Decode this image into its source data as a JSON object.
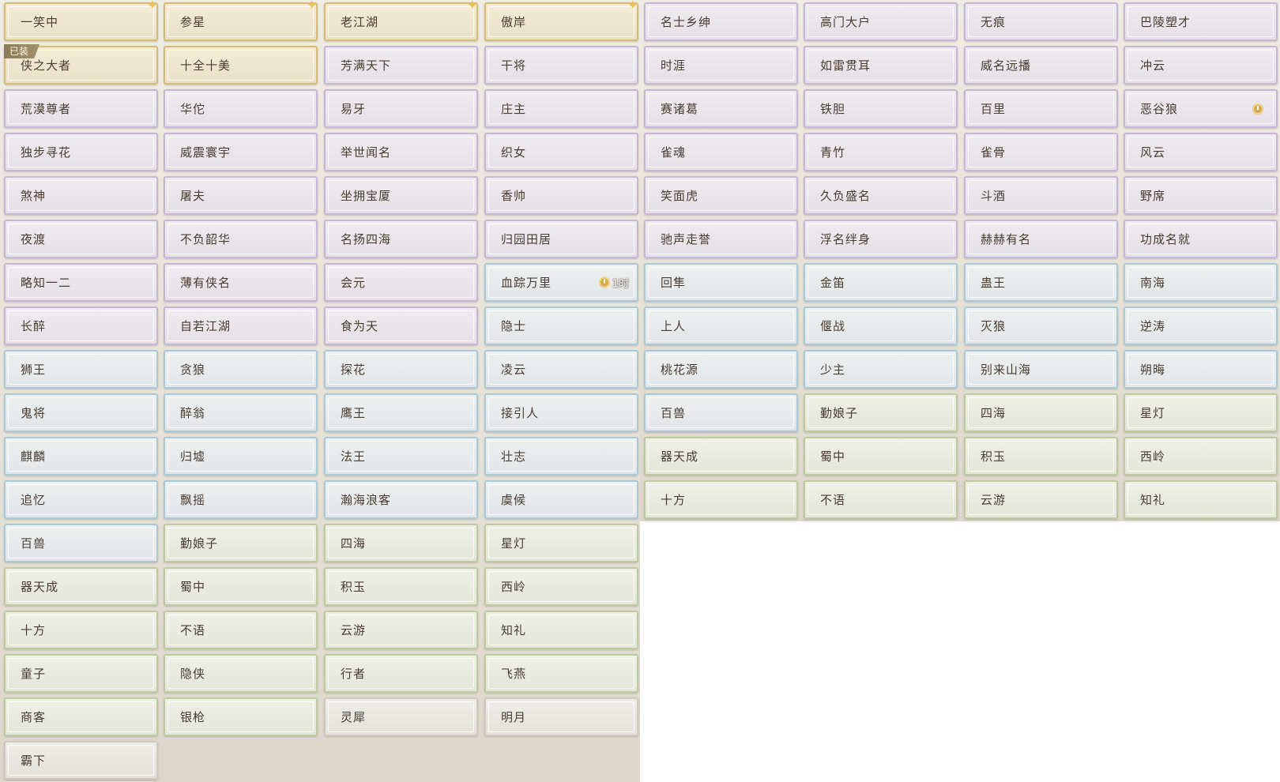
{
  "title_grid_right": {
    "rows": [
      [
        {
          "label": "名士乡绅",
          "tier": "purple"
        },
        {
          "label": "高门大户",
          "tier": "purple"
        },
        {
          "label": "无痕",
          "tier": "purple"
        },
        {
          "label": "巴陵塑才",
          "tier": "purple"
        }
      ],
      [
        {
          "label": "时涯",
          "tier": "purple"
        },
        {
          "label": "如雷贯耳",
          "tier": "purple"
        },
        {
          "label": "威名远播",
          "tier": "purple"
        },
        {
          "label": "冲云",
          "tier": "purple"
        }
      ],
      [
        {
          "label": "赛诸葛",
          "tier": "purple"
        },
        {
          "label": "铁胆",
          "tier": "purple"
        },
        {
          "label": "百里",
          "tier": "purple"
        },
        {
          "label": "恶谷狼",
          "tier": "purple",
          "timed": true
        }
      ],
      [
        {
          "label": "雀魂",
          "tier": "purple"
        },
        {
          "label": "青竹",
          "tier": "purple"
        },
        {
          "label": "雀骨",
          "tier": "purple"
        },
        {
          "label": "风云",
          "tier": "purple"
        }
      ],
      [
        {
          "label": "笑面虎",
          "tier": "purple"
        },
        {
          "label": "久负盛名",
          "tier": "purple"
        },
        {
          "label": "斗酒",
          "tier": "purple"
        },
        {
          "label": "野席",
          "tier": "purple"
        }
      ],
      [
        {
          "label": "驰声走誉",
          "tier": "purple"
        },
        {
          "label": "浮名绊身",
          "tier": "purple"
        },
        {
          "label": "赫赫有名",
          "tier": "purple"
        },
        {
          "label": "功成名就",
          "tier": "purple"
        }
      ],
      [
        {
          "label": "回隼",
          "tier": "blue"
        },
        {
          "label": "金笛",
          "tier": "blue"
        },
        {
          "label": "蛊王",
          "tier": "blue"
        },
        {
          "label": "南海",
          "tier": "blue"
        }
      ],
      [
        {
          "label": "上人",
          "tier": "blue"
        },
        {
          "label": "偃战",
          "tier": "blue"
        },
        {
          "label": "灭狼",
          "tier": "blue"
        },
        {
          "label": "逆涛",
          "tier": "blue"
        }
      ],
      [
        {
          "label": "桃花源",
          "tier": "blue"
        },
        {
          "label": "少主",
          "tier": "blue"
        },
        {
          "label": "别来山海",
          "tier": "blue"
        },
        {
          "label": "朔晦",
          "tier": "blue"
        }
      ],
      [
        {
          "label": "百兽",
          "tier": "blue"
        },
        {
          "label": "勤娘子",
          "tier": "green"
        },
        {
          "label": "四海",
          "tier": "green"
        },
        {
          "label": "星灯",
          "tier": "green"
        }
      ],
      [
        {
          "label": "器天成",
          "tier": "green"
        },
        {
          "label": "蜀中",
          "tier": "green"
        },
        {
          "label": "积玉",
          "tier": "green"
        },
        {
          "label": "西岭",
          "tier": "green"
        }
      ],
      [
        {
          "label": "十方",
          "tier": "green"
        },
        {
          "label": "不语",
          "tier": "green"
        },
        {
          "label": "云游",
          "tier": "green"
        },
        {
          "label": "知礼",
          "tier": "green"
        }
      ]
    ]
  },
  "title_grid_left": {
    "rows": [
      [
        {
          "label": "一笑中",
          "tier": "gold",
          "sparkle": true
        },
        {
          "label": "参星",
          "tier": "gold",
          "sparkle": true
        },
        {
          "label": "老江湖",
          "tier": "gold",
          "sparkle": true
        },
        {
          "label": "傲岸",
          "tier": "gold",
          "sparkle": true
        }
      ],
      [
        {
          "label": "侠之大者",
          "tier": "gold",
          "equipped": true
        },
        {
          "label": "十全十美",
          "tier": "gold"
        },
        {
          "label": "芳满天下",
          "tier": "purple"
        },
        {
          "label": "干将",
          "tier": "purple"
        }
      ],
      [
        {
          "label": "荒漠尊者",
          "tier": "purple"
        },
        {
          "label": "华佗",
          "tier": "purple"
        },
        {
          "label": "易牙",
          "tier": "purple"
        },
        {
          "label": "庄主",
          "tier": "purple"
        }
      ],
      [
        {
          "label": "独步寻花",
          "tier": "purple"
        },
        {
          "label": "威震寰宇",
          "tier": "purple"
        },
        {
          "label": "举世闻名",
          "tier": "purple"
        },
        {
          "label": "织女",
          "tier": "purple"
        }
      ],
      [
        {
          "label": "煞神",
          "tier": "purple"
        },
        {
          "label": "屠夫",
          "tier": "purple"
        },
        {
          "label": "坐拥宝厦",
          "tier": "purple"
        },
        {
          "label": "香帅",
          "tier": "purple"
        }
      ],
      [
        {
          "label": "夜渡",
          "tier": "purple"
        },
        {
          "label": "不负韶华",
          "tier": "purple"
        },
        {
          "label": "名扬四海",
          "tier": "purple"
        },
        {
          "label": "归园田居",
          "tier": "purple"
        }
      ],
      [
        {
          "label": "略知一二",
          "tier": "purple"
        },
        {
          "label": "薄有侠名",
          "tier": "purple"
        },
        {
          "label": "会元",
          "tier": "purple"
        },
        {
          "label": "血踪万里",
          "tier": "blue",
          "timer": "1时"
        }
      ],
      [
        {
          "label": "长醉",
          "tier": "purple"
        },
        {
          "label": "自若江湖",
          "tier": "purple"
        },
        {
          "label": "食为天",
          "tier": "purple"
        },
        {
          "label": "隐士",
          "tier": "blue"
        }
      ],
      [
        {
          "label": "狮王",
          "tier": "blue"
        },
        {
          "label": "贪狼",
          "tier": "blue"
        },
        {
          "label": "探花",
          "tier": "blue"
        },
        {
          "label": "凌云",
          "tier": "blue"
        }
      ],
      [
        {
          "label": "鬼将",
          "tier": "blue"
        },
        {
          "label": "醉翁",
          "tier": "blue"
        },
        {
          "label": "鹰王",
          "tier": "blue"
        },
        {
          "label": "接引人",
          "tier": "blue"
        }
      ],
      [
        {
          "label": "麒麟",
          "tier": "blue"
        },
        {
          "label": "归墟",
          "tier": "blue"
        },
        {
          "label": "法王",
          "tier": "blue"
        },
        {
          "label": "壮志",
          "tier": "blue"
        }
      ],
      [
        {
          "label": "追忆",
          "tier": "blue"
        },
        {
          "label": "飘摇",
          "tier": "blue"
        },
        {
          "label": "瀚海浪客",
          "tier": "blue"
        },
        {
          "label": "虞候",
          "tier": "blue"
        }
      ],
      [
        {
          "label": "百兽",
          "tier": "blue"
        },
        {
          "label": "勤娘子",
          "tier": "green"
        },
        {
          "label": "四海",
          "tier": "green"
        },
        {
          "label": "星灯",
          "tier": "green"
        }
      ],
      [
        {
          "label": "器天成",
          "tier": "green"
        },
        {
          "label": "蜀中",
          "tier": "green"
        },
        {
          "label": "积玉",
          "tier": "green"
        },
        {
          "label": "西岭",
          "tier": "green"
        }
      ],
      [
        {
          "label": "十方",
          "tier": "green"
        },
        {
          "label": "不语",
          "tier": "green"
        },
        {
          "label": "云游",
          "tier": "green"
        },
        {
          "label": "知礼",
          "tier": "green"
        }
      ],
      [
        {
          "label": "童子",
          "tier": "green"
        },
        {
          "label": "隐侠",
          "tier": "green"
        },
        {
          "label": "行者",
          "tier": "green"
        },
        {
          "label": "飞燕",
          "tier": "green"
        }
      ],
      [
        {
          "label": "商客",
          "tier": "green"
        },
        {
          "label": "银枪",
          "tier": "green"
        },
        {
          "label": "灵犀",
          "tier": "gray"
        },
        {
          "label": "明月",
          "tier": "gray"
        }
      ],
      [
        {
          "label": "霸下",
          "tier": "gray"
        }
      ]
    ]
  },
  "badges": {
    "equipped_label": "已装"
  },
  "colors": {
    "gold": "#d9bb73",
    "purple": "#c6b6d8",
    "blue": "#a9cadb",
    "green": "#bccc9f",
    "text": "#4a3c30"
  },
  "icons": {
    "sparkle": "sparkle-icon",
    "timer": "clock-icon"
  }
}
